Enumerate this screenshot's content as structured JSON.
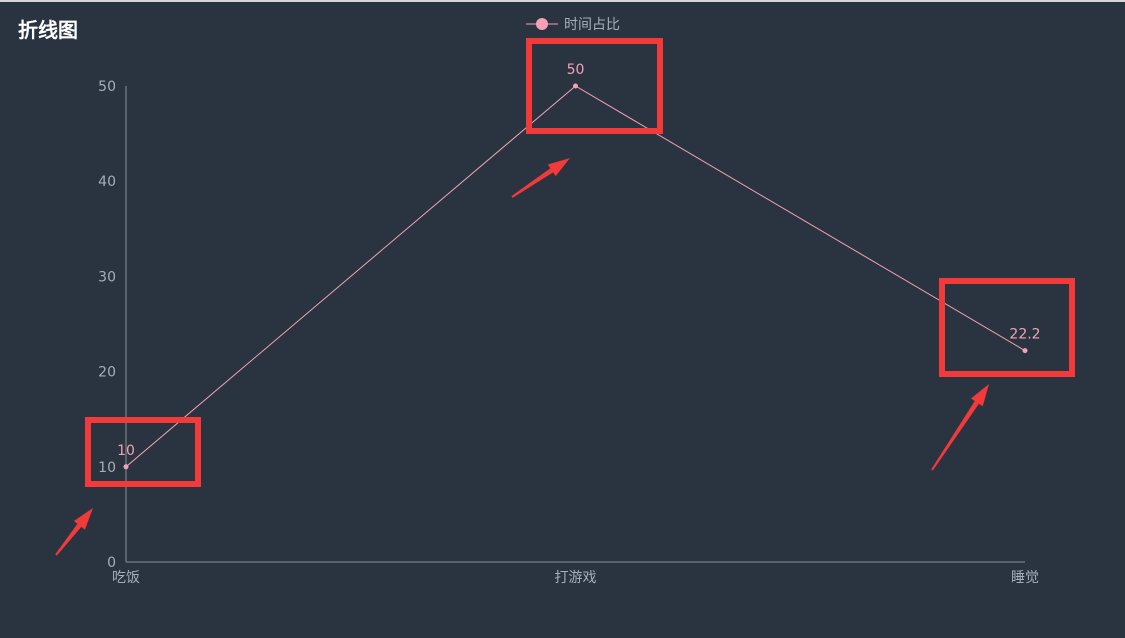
{
  "chart_data": {
    "type": "line",
    "title": "折线图",
    "categories": [
      "吃饭",
      "打游戏",
      "睡觉"
    ],
    "series": [
      {
        "name": "时间占比",
        "values": [
          10,
          50,
          22.2
        ],
        "color": "#f4a1b6"
      }
    ],
    "ylim": [
      0,
      50
    ],
    "yticks": [
      0,
      10,
      20,
      30,
      40,
      50
    ],
    "grid": false,
    "legend_position": "top-center",
    "annotations": {
      "highlight_color": "#f23a3a",
      "highlighted_points": [
        0,
        1,
        2
      ]
    }
  }
}
